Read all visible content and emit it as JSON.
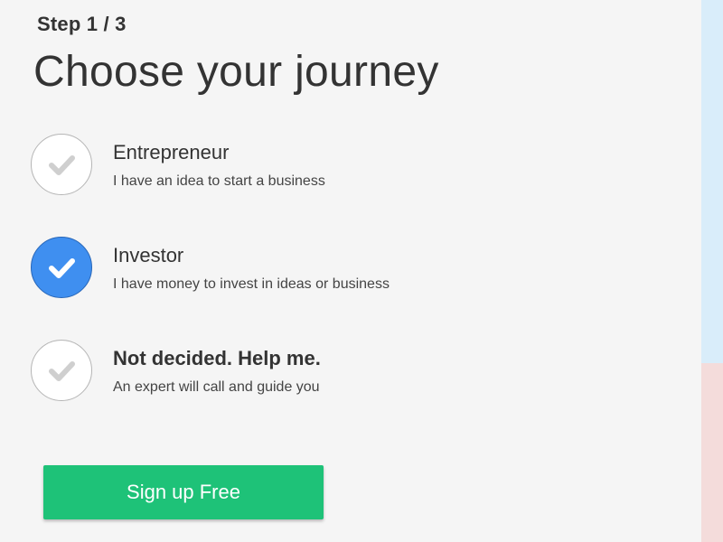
{
  "step_label": "Step 1 / 3",
  "page_title": "Choose your journey",
  "options": [
    {
      "title": "Entrepreneur",
      "description": "I have an idea to start a business",
      "selected": false,
      "icon": "check-icon"
    },
    {
      "title": "Investor",
      "description": "I have money to invest in ideas or business",
      "selected": true,
      "icon": "check-icon"
    },
    {
      "title": "Not decided. Help me.",
      "description": "An expert will call and guide you",
      "selected": false,
      "icon": "check-icon"
    }
  ],
  "cta": {
    "label": "Sign up Free"
  },
  "colors": {
    "background": "#f5f5f5",
    "selected_circle": "#3f8ff0",
    "unselected_check": "#cfcfcf",
    "cta": "#1ec278",
    "side_top": "#d9edfa",
    "side_bottom": "#f4dcdb",
    "text": "#333333"
  }
}
